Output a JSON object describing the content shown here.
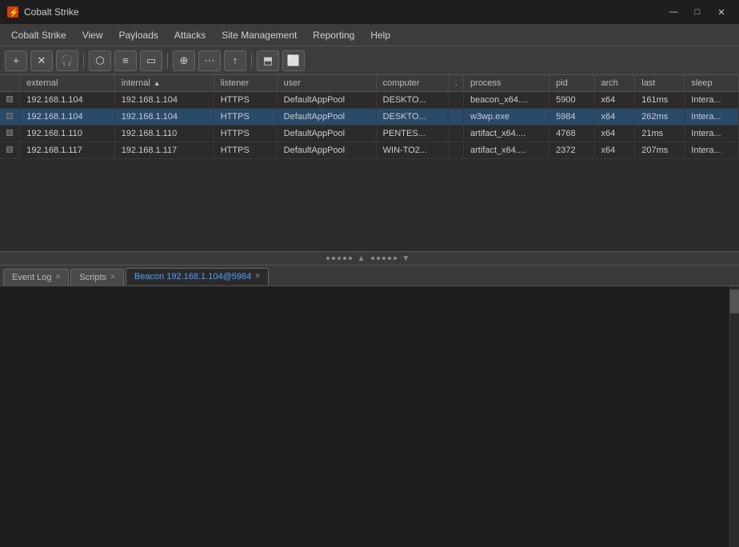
{
  "titlebar": {
    "icon": "⚡",
    "title": "Cobalt Strike",
    "minimize": "—",
    "maximize": "□",
    "close": "✕"
  },
  "menubar": {
    "items": [
      {
        "label": "Cobalt Strike",
        "id": "cobalt-strike"
      },
      {
        "label": "View",
        "id": "view"
      },
      {
        "label": "Payloads",
        "id": "payloads"
      },
      {
        "label": "Attacks",
        "id": "attacks"
      },
      {
        "label": "Site Management",
        "id": "site-management"
      },
      {
        "label": "Reporting",
        "id": "reporting"
      },
      {
        "label": "Help",
        "id": "help"
      }
    ]
  },
  "toolbar": {
    "buttons": [
      {
        "id": "connect",
        "icon": "+",
        "title": "Connect"
      },
      {
        "id": "disconnect",
        "icon": "✕",
        "title": "Disconnect"
      },
      {
        "id": "headphones",
        "icon": "🎧",
        "title": "Listeners"
      },
      {
        "id": "share",
        "icon": "⬡",
        "title": "Share"
      },
      {
        "id": "list",
        "icon": "≡",
        "title": "Sessions"
      },
      {
        "id": "screen",
        "icon": "▭",
        "title": "Screen"
      },
      {
        "id": "globe",
        "icon": "⊕",
        "title": "Web"
      },
      {
        "id": "dots",
        "icon": "⋯",
        "title": "Misc"
      },
      {
        "id": "upload",
        "icon": "↑",
        "title": "Upload"
      },
      {
        "id": "pivot",
        "icon": "⬒",
        "title": "Pivot"
      },
      {
        "id": "screenshot",
        "icon": "⬜",
        "title": "Screenshot"
      }
    ]
  },
  "table": {
    "columns": [
      {
        "id": "indicator",
        "label": "",
        "class": "col-indicator"
      },
      {
        "id": "external",
        "label": "external",
        "class": "col-external"
      },
      {
        "id": "internal",
        "label": "internal",
        "class": "col-internal",
        "sorted": "asc"
      },
      {
        "id": "listener",
        "label": "listener",
        "class": "col-listener"
      },
      {
        "id": "user",
        "label": "user",
        "class": "col-user"
      },
      {
        "id": "computer",
        "label": "computer",
        "class": "col-computer"
      },
      {
        "id": "dot",
        "label": ".",
        "class": "col-dot"
      },
      {
        "id": "process",
        "label": "process",
        "class": "col-process"
      },
      {
        "id": "pid",
        "label": "pid",
        "class": "col-pid"
      },
      {
        "id": "arch",
        "label": "arch",
        "class": "col-arch"
      },
      {
        "id": "last",
        "label": "last",
        "class": "col-last"
      },
      {
        "id": "sleep",
        "label": "sleep",
        "class": "col-sleep"
      }
    ],
    "rows": [
      {
        "external": "192.168.1.104",
        "internal": "192.168.1.104",
        "listener": "HTTPS",
        "user": "DefaultAppPool",
        "computer": "DESKTO...",
        "dot": "",
        "process": "beacon_x64....",
        "pid": "5900",
        "arch": "x64",
        "last": "161ms",
        "sleep": "Intera..."
      },
      {
        "external": "192.168.1.104",
        "internal": "192.168.1.104",
        "listener": "HTTPS",
        "user": "DefaultAppPool",
        "computer": "DESKTO...",
        "dot": "",
        "process": "w3wp.exe",
        "pid": "5984",
        "arch": "x64",
        "last": "262ms",
        "sleep": "Intera...",
        "selected": true
      },
      {
        "external": "192.168.1.110",
        "internal": "192.168.1.110",
        "listener": "HTTPS",
        "user": "DefaultAppPool",
        "computer": "PENTES...",
        "dot": "",
        "process": "artifact_x64....",
        "pid": "4768",
        "arch": "x64",
        "last": "21ms",
        "sleep": "Intera..."
      },
      {
        "external": "192.168.1.117",
        "internal": "192.168.1.117",
        "listener": "HTTPS",
        "user": "DefaultAppPool",
        "computer": "WIN-TO2...",
        "dot": "",
        "process": "artifact_x64....",
        "pid": "2372",
        "arch": "x64",
        "last": "207ms",
        "sleep": "Intera..."
      }
    ]
  },
  "divider": {
    "dots": [
      "•",
      "•",
      "•",
      "•",
      "•"
    ]
  },
  "bottom_tabs": [
    {
      "label": "Event Log",
      "id": "event-log",
      "active": false,
      "closable": true
    },
    {
      "label": "Scripts",
      "id": "scripts",
      "active": false,
      "closable": true
    },
    {
      "label": "Beacon 192.168.1.104@5984",
      "id": "beacon",
      "active": true,
      "closable": true
    }
  ]
}
